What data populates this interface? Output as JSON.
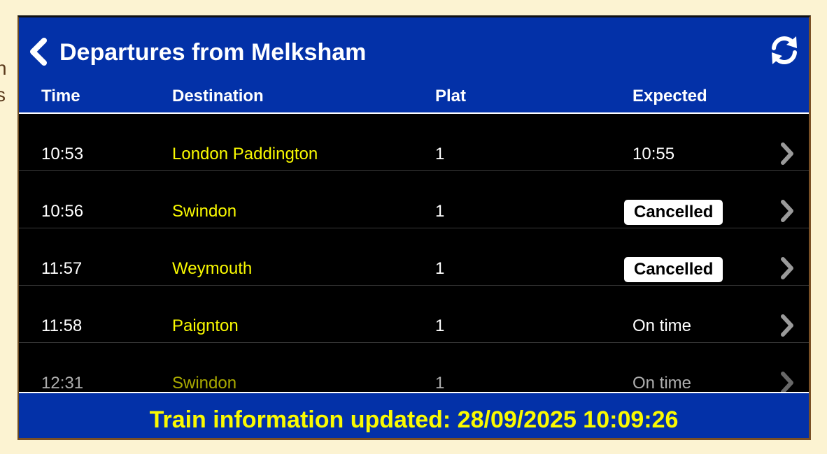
{
  "background_text": [
    "n",
    "s"
  ],
  "header": {
    "title": "Departures from Melksham",
    "back_icon": "chevron-left-icon",
    "refresh_icon": "refresh-icon",
    "color": "#0331a8"
  },
  "columns": {
    "time": "Time",
    "destination": "Destination",
    "platform": "Plat",
    "expected": "Expected"
  },
  "departures": [
    {
      "time": "10:53",
      "destination": "London Paddington",
      "platform": "1",
      "expected": "10:55",
      "cancelled": false
    },
    {
      "time": "10:56",
      "destination": "Swindon",
      "platform": "1",
      "expected": "Cancelled",
      "cancelled": true
    },
    {
      "time": "11:57",
      "destination": "Weymouth",
      "platform": "1",
      "expected": "Cancelled",
      "cancelled": true
    },
    {
      "time": "11:58",
      "destination": "Paignton",
      "platform": "1",
      "expected": "On time",
      "cancelled": false
    },
    {
      "time": "12:31",
      "destination": "Swindon",
      "platform": "1",
      "expected": "On time",
      "cancelled": false
    }
  ],
  "footer": {
    "label": "Train information updated: 28/09/2025 10:09:26"
  },
  "colors": {
    "destination": "#fafa00",
    "board": "#000000",
    "page": "#fcf3d2"
  }
}
